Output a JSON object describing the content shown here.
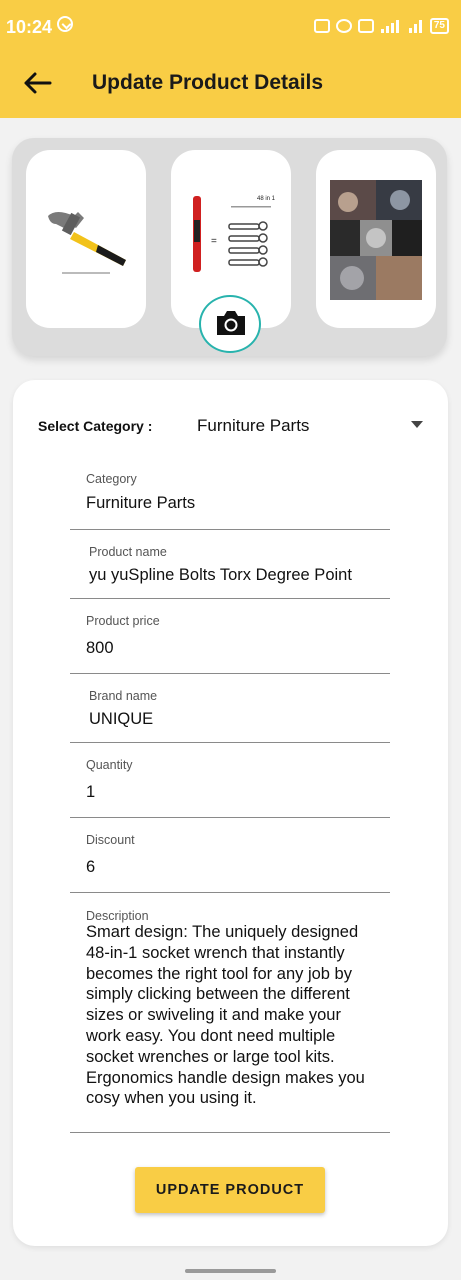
{
  "status": {
    "time": "10:24",
    "battery": "75"
  },
  "header": {
    "title": "Update Product Details"
  },
  "form": {
    "category_label": "Select Category :",
    "category_selected": "Furniture Parts",
    "fields": [
      {
        "label": "Category",
        "value": "Furniture Parts"
      },
      {
        "label": "Product name",
        "value": "yu yuSpline Bolts Torx  Degree Point"
      },
      {
        "label": "Product price",
        "value": "800"
      },
      {
        "label": "Brand name",
        "value": "UNIQUE"
      },
      {
        "label": "Quantity",
        "value": "1"
      },
      {
        "label": "Discount",
        "value": "6"
      },
      {
        "label": "Description",
        "value": "Smart design: The uniquely designed 48-in-1 socket wrench that instantly becomes the right tool for any job by simply clicking between the different sizes or swiveling it and make your work easy. You dont need multiple socket wrenches or large tool kits. Ergonomics handle design makes you cosy when you using it."
      }
    ],
    "update_button": "UPDATE PRODUCT"
  },
  "images": {
    "thumb_2_caption": "48 in 1"
  },
  "colors": {
    "accent": "#f9cd45",
    "camera_border": "#28b3ad"
  }
}
